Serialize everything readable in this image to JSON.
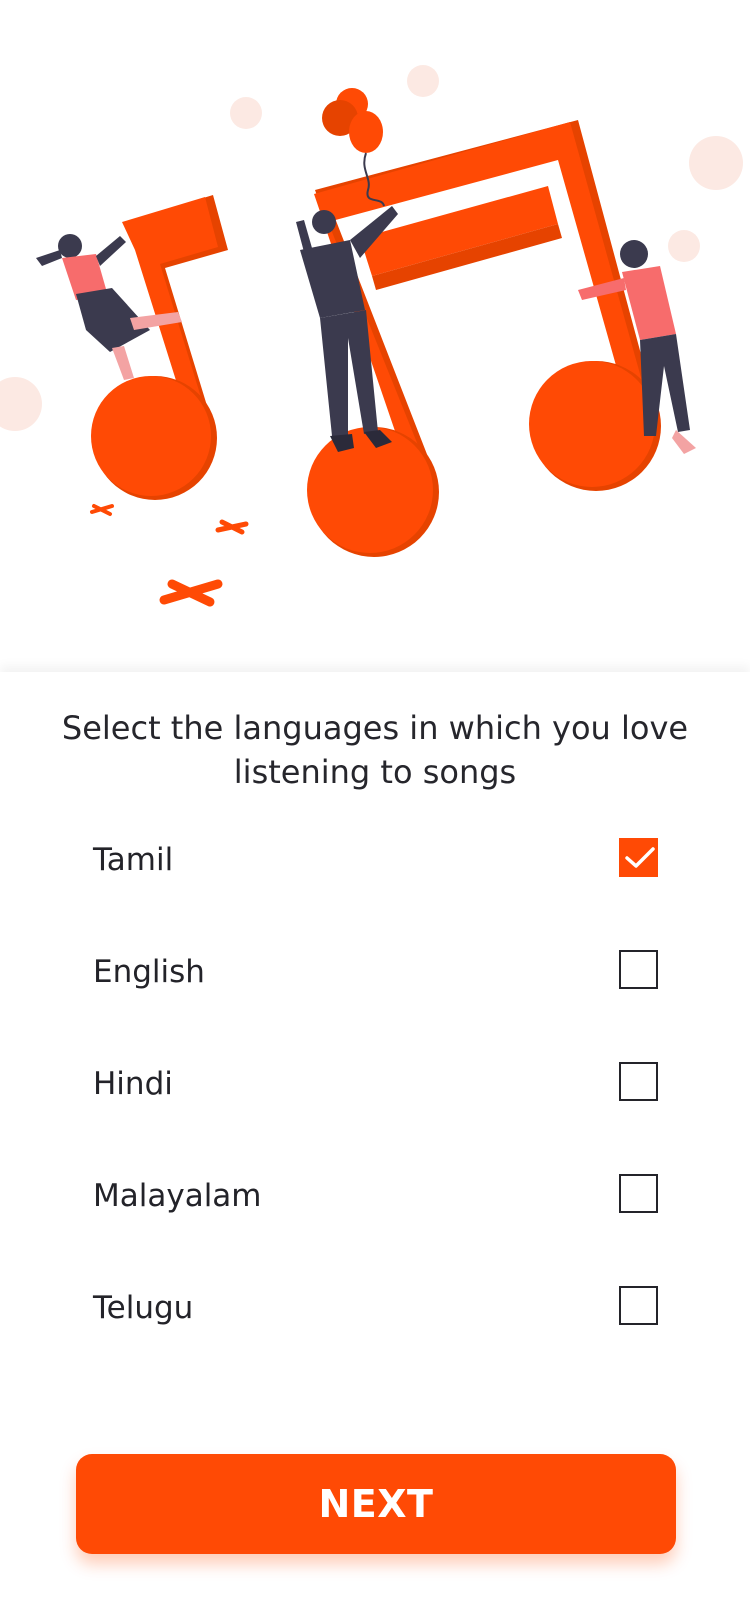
{
  "colors": {
    "accent": "#FF4A05",
    "text": "#232329",
    "illustration_dark": "#3B3A4E",
    "illustration_pink": "#F76C6C",
    "bubble": "#FCE9E3"
  },
  "hero": {
    "illustration": "music-notes-people-illustration"
  },
  "prompt": "Select the languages in which you love listening to songs",
  "languages": [
    {
      "label": "Tamil",
      "checked": true
    },
    {
      "label": "English",
      "checked": false
    },
    {
      "label": "Hindi",
      "checked": false
    },
    {
      "label": "Malayalam",
      "checked": false
    },
    {
      "label": "Telugu",
      "checked": false
    }
  ],
  "next_label": "NEXT"
}
